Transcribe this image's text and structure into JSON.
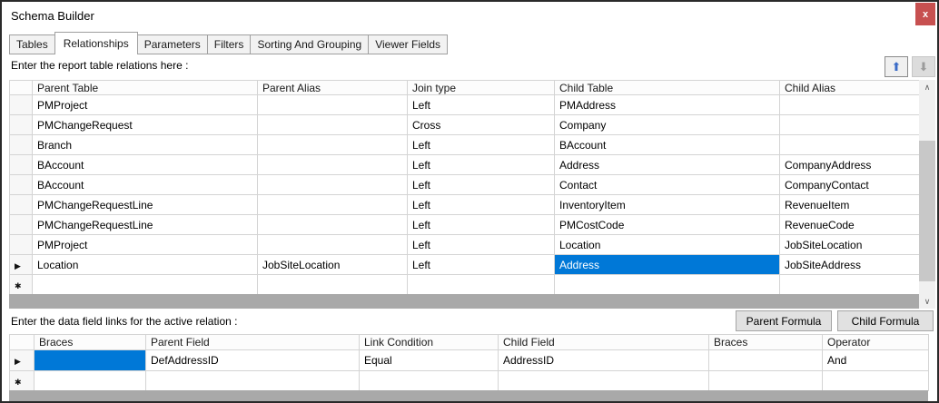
{
  "window": {
    "title": "Schema Builder"
  },
  "icons": {
    "close": "x",
    "move_up": "⬆",
    "move_down": "⬇",
    "scroll_up": "∧",
    "scroll_down": "∨",
    "current_row": "▶",
    "new_row": "✱"
  },
  "colors": {
    "selection": "#0078d7",
    "close_button": "#c75050",
    "grid_backdrop": "#a9a9a9"
  },
  "tabs": [
    "Tables",
    "Relationships",
    "Parameters",
    "Filters",
    "Sorting And Grouping",
    "Viewer Fields"
  ],
  "active_tab": "Relationships",
  "relations_section": {
    "label": "Enter the report table relations here :",
    "grid": {
      "columns": [
        "Parent Table",
        "Parent Alias",
        "Join type",
        "Child Table",
        "Child Alias"
      ],
      "rows": [
        {
          "parent_table": "PMProject",
          "parent_alias": "",
          "join_type": "Left",
          "child_table": "PMAddress",
          "child_alias": ""
        },
        {
          "parent_table": "PMChangeRequest",
          "parent_alias": "",
          "join_type": "Cross",
          "child_table": "Company",
          "child_alias": ""
        },
        {
          "parent_table": "Branch",
          "parent_alias": "",
          "join_type": "Left",
          "child_table": "BAccount",
          "child_alias": ""
        },
        {
          "parent_table": "BAccount",
          "parent_alias": "",
          "join_type": "Left",
          "child_table": "Address",
          "child_alias": "CompanyAddress"
        },
        {
          "parent_table": "BAccount",
          "parent_alias": "",
          "join_type": "Left",
          "child_table": "Contact",
          "child_alias": "CompanyContact"
        },
        {
          "parent_table": "PMChangeRequestLine",
          "parent_alias": "",
          "join_type": "Left",
          "child_table": "InventoryItem",
          "child_alias": "RevenueItem"
        },
        {
          "parent_table": "PMChangeRequestLine",
          "parent_alias": "",
          "join_type": "Left",
          "child_table": "PMCostCode",
          "child_alias": "RevenueCode"
        },
        {
          "parent_table": "PMProject",
          "parent_alias": "",
          "join_type": "Left",
          "child_table": "Location",
          "child_alias": "JobSiteLocation"
        },
        {
          "parent_table": "Location",
          "parent_alias": "JobSiteLocation",
          "join_type": "Left",
          "child_table": "Address",
          "child_alias": "JobSiteAddress"
        },
        {
          "parent_table": "",
          "parent_alias": "",
          "join_type": "",
          "child_table": "",
          "child_alias": ""
        }
      ],
      "selected_cell": {
        "row_index": 8,
        "column": "Child Table",
        "value": "Address"
      },
      "current_row_index": 8
    }
  },
  "links_section": {
    "label": "Enter the data field links for the active relation :",
    "buttons": [
      "Parent Formula",
      "Child Formula"
    ],
    "grid": {
      "columns": [
        "Braces",
        "Parent Field",
        "Link Condition",
        "Child Field",
        "Braces",
        "Operator"
      ],
      "rows": [
        {
          "braces": "",
          "parent_field": "DefAddressID",
          "link_condition": "Equal",
          "child_field": "AddressID",
          "braces2": "",
          "operator": "And"
        },
        {
          "braces": "",
          "parent_field": "",
          "link_condition": "",
          "child_field": "",
          "braces2": "",
          "operator": ""
        }
      ],
      "selected_cell": {
        "row_index": 0,
        "column": "Braces",
        "value": ""
      },
      "current_row_index": 0
    }
  }
}
